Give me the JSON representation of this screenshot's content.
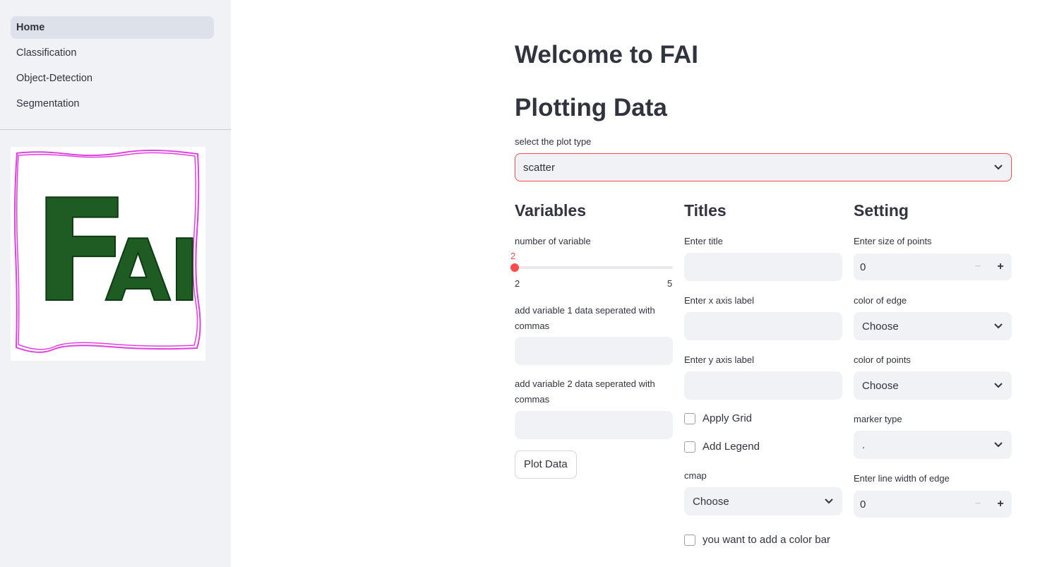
{
  "sidebar": {
    "nav_items": [
      {
        "label": "Home",
        "active": true
      },
      {
        "label": "Classification",
        "active": false
      },
      {
        "label": "Object-Detection",
        "active": false
      },
      {
        "label": "Segmentation",
        "active": false
      }
    ],
    "logo_text": "FAI"
  },
  "main": {
    "welcome_title": "Welcome to FAI",
    "section_title": "Plotting Data",
    "plot_type": {
      "label": "select the plot type",
      "value": "scatter"
    },
    "variables": {
      "heading": "Variables",
      "slider": {
        "label": "number of variable",
        "value": 2,
        "min": 2,
        "max": 5
      },
      "var1_label": "add variable 1 data seperated with commas",
      "var1_value": "",
      "var2_label": "add variable 2 data seperated with commas",
      "var2_value": "",
      "plot_button": "Plot Data"
    },
    "titles": {
      "heading": "Titles",
      "title_label": "Enter title",
      "title_value": "",
      "xaxis_label": "Enter x axis label",
      "xaxis_value": "",
      "yaxis_label": "Enter y axis label",
      "yaxis_value": "",
      "apply_grid": "Apply Grid",
      "add_legend": "Add Legend",
      "cmap_label": "cmap",
      "cmap_value": "Choose",
      "colorbar": "you want to add a color bar"
    },
    "setting": {
      "heading": "Setting",
      "size_label": "Enter size of points",
      "size_value": "0",
      "edge_color_label": "color of edge",
      "edge_color_value": "Choose",
      "point_color_label": "color of points",
      "point_color_value": "Choose",
      "marker_label": "marker type",
      "marker_value": ".",
      "linewidth_label": "Enter line width of edge",
      "linewidth_value": "0"
    }
  },
  "colors": {
    "accent": "#ff4b4b",
    "sidebar_bg": "#f0f2f6",
    "logo_green": "#1e5c24",
    "logo_frame": "#e040e0"
  }
}
